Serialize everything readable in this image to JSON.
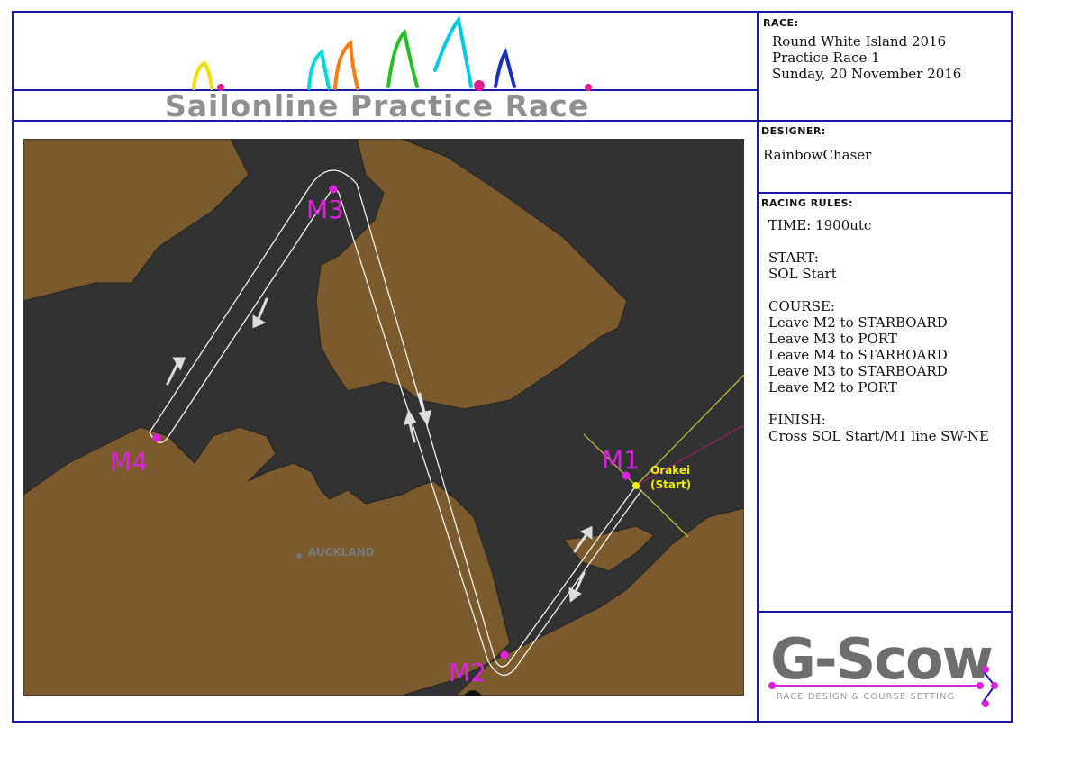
{
  "header": {
    "title": "Sailonline Practice Race"
  },
  "race": {
    "heading": "RACE:",
    "name": "Round White Island 2016",
    "subtitle": "Practice Race 1",
    "date": "Sunday, 20 November 2016"
  },
  "designer": {
    "heading": "DESIGNER:",
    "name": "RainbowChaser"
  },
  "rules": {
    "heading": "RACING RULES:",
    "lines": [
      "TIME: 1900utc",
      "",
      "START:",
      "SOL Start",
      "",
      "COURSE:",
      "Leave M2 to STARBOARD",
      "Leave M3 to PORT",
      "Leave M4 to STARBOARD",
      "Leave M3 to STARBOARD",
      "Leave M2 to PORT",
      "",
      "FINISH:",
      "Cross SOL Start/M1 line SW-NE"
    ]
  },
  "map": {
    "marks": [
      "M1",
      "M2",
      "M3",
      "M4"
    ],
    "start_label": "Orakei",
    "start_sub": "(Start)",
    "city_label": "AUCKLAND",
    "colors": {
      "land": "#7b5a2e",
      "water": "#323232",
      "marks": "#e020e0",
      "start": "#f0f000",
      "route": "#ffffff"
    }
  },
  "logo": {
    "name": "G-Scow",
    "tagline": "RACE DESIGN & COURSE SETTING"
  }
}
